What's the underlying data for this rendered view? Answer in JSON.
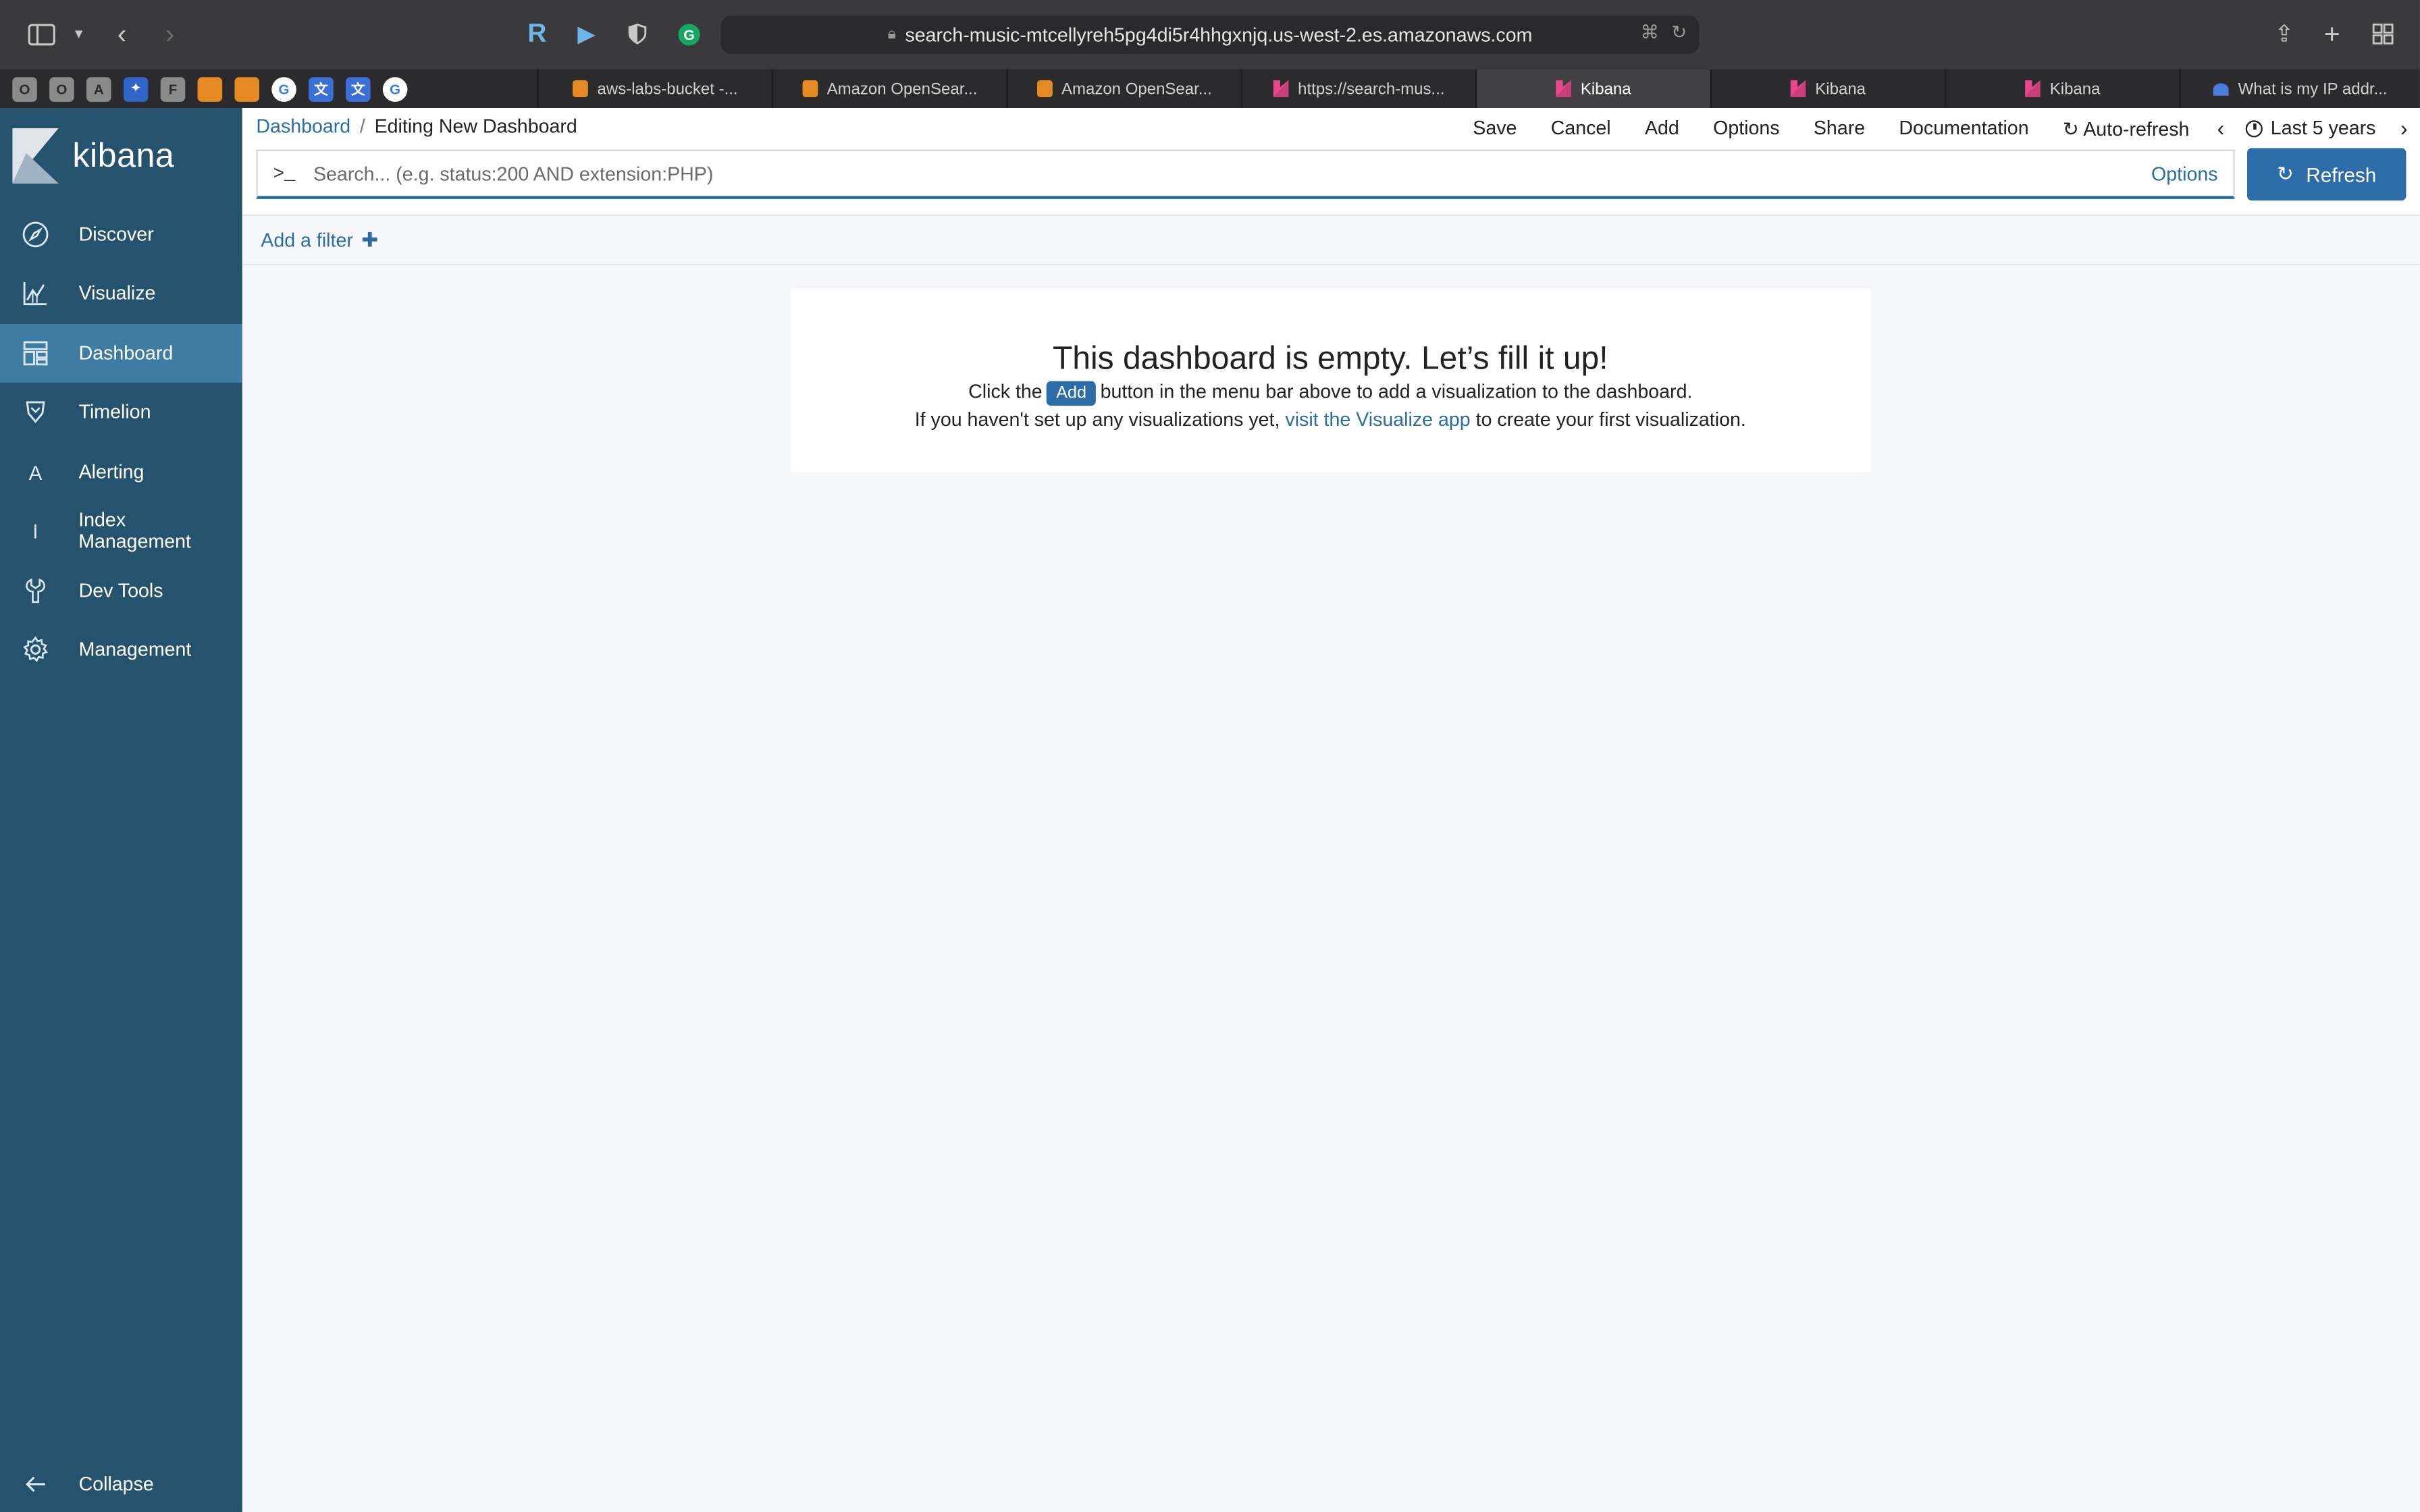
{
  "browser": {
    "url": "search-music-mtcellyreh5pg4di5r4hhgxnjq.us-west-2.es.amazonaws.com",
    "pinned_tabs": [
      "O",
      "O",
      "A",
      "",
      "F",
      "",
      "",
      "G",
      "",
      "",
      "G"
    ],
    "tabs": [
      {
        "label": "aws-labs-bucket -...",
        "icon": "aws"
      },
      {
        "label": "Amazon OpenSear...",
        "icon": "aws"
      },
      {
        "label": "Amazon OpenSear...",
        "icon": "aws"
      },
      {
        "label": "https://search-mus...",
        "icon": "kibana"
      },
      {
        "label": "Kibana",
        "icon": "kibana",
        "active": true
      },
      {
        "label": "Kibana",
        "icon": "kibana"
      },
      {
        "label": "Kibana",
        "icon": "kibana"
      },
      {
        "label": "What is my IP addr...",
        "icon": "ip"
      }
    ]
  },
  "sidebar": {
    "brand": "kibana",
    "items": [
      {
        "label": "Discover",
        "icon": "compass-icon"
      },
      {
        "label": "Visualize",
        "icon": "chart-icon"
      },
      {
        "label": "Dashboard",
        "icon": "dashboard-icon",
        "active": true
      },
      {
        "label": "Timelion",
        "icon": "timelion-icon"
      },
      {
        "label": "Alerting",
        "icon": "letter-a-icon",
        "glyph": "A"
      },
      {
        "label": "Index Management",
        "icon": "letter-i-icon",
        "glyph": "I"
      },
      {
        "label": "Dev Tools",
        "icon": "wrench-icon"
      },
      {
        "label": "Management",
        "icon": "gear-icon"
      }
    ],
    "collapse_label": "Collapse"
  },
  "topnav": {
    "breadcrumb_root": "Dashboard",
    "breadcrumb_current": "Editing New Dashboard",
    "menu": [
      "Save",
      "Cancel",
      "Add",
      "Options",
      "Share",
      "Documentation"
    ],
    "auto_refresh": "Auto-refresh",
    "time_range": "Last 5 years"
  },
  "search": {
    "prompt": ">_",
    "placeholder": "Search... (e.g. status:200 AND extension:PHP)",
    "options_label": "Options",
    "refresh_label": "Refresh"
  },
  "filters": {
    "add_label": "Add a filter"
  },
  "empty": {
    "title": "This dashboard is empty. Let’s fill it up!",
    "line1_pre": "Click the",
    "line1_chip": "Add",
    "line1_post": "button in the menu bar above to add a visualization to the dashboard.",
    "line2_pre": "If you haven't set up any visualizations yet,",
    "line2_link": "visit the Visualize app",
    "line2_post": "to create your first visualization."
  },
  "colors": {
    "sidebar_bg": "#25536e",
    "sidebar_active": "#3f7ca3",
    "accent": "#2c6ca8",
    "link": "#2a6ca4"
  }
}
